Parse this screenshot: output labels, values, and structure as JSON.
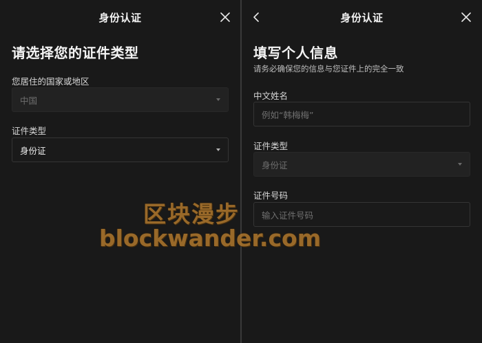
{
  "left_panel": {
    "nav_title": "身份认证",
    "heading": "请选择您的证件类型",
    "country_label": "您居住的国家或地区",
    "country_value": "中国",
    "id_type_label": "证件类型",
    "id_type_value": "身份证",
    "close_icon": "close-icon",
    "dropdown_icon": "caret-down-icon"
  },
  "right_panel": {
    "nav_title": "身份认证",
    "heading": "填写个人信息",
    "subtext": "请务必确保您的信息与您证件上的完全一致",
    "name_label": "中文姓名",
    "name_placeholder": "例如“韩梅梅”",
    "id_type_label": "证件类型",
    "id_type_value": "身份证",
    "id_number_label": "证件号码",
    "id_number_placeholder": "输入证件号码",
    "back_icon": "chevron-left-icon",
    "close_icon": "close-icon",
    "dropdown_icon": "caret-down-icon"
  },
  "watermark": {
    "line1": "区块漫步",
    "line2": "blockwander.com"
  }
}
